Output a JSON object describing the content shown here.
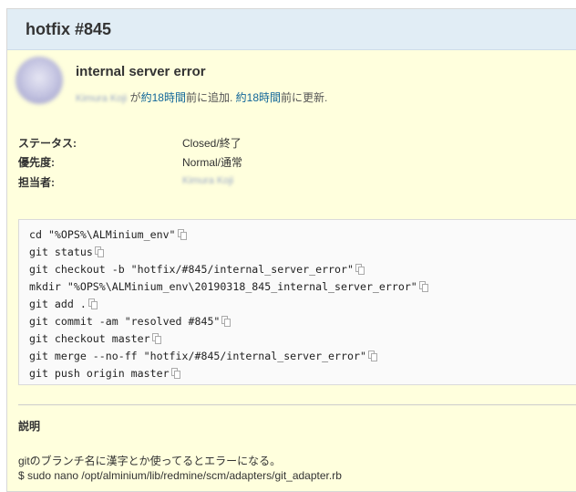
{
  "issue": {
    "title": "hotfix #845",
    "subject": "internal server error"
  },
  "meta": {
    "author": "Kimura Koji",
    "by": "が",
    "created_link": "約18時間",
    "created_suffix": "前に追加.",
    "updated_link": "約18時間",
    "updated_suffix": "前に更新."
  },
  "attributes": {
    "status_label": "ステータス:",
    "status_value": "Closed/終了",
    "priority_label": "優先度:",
    "priority_value": "Normal/通常",
    "assignee_label": "担当者:",
    "assignee_value": "Kimura Koji"
  },
  "code_lines": [
    "cd \"%OPS%\\ALMinium_env\"",
    "git status",
    "git checkout -b \"hotfix/#845/internal_server_error\"",
    "mkdir \"%OPS%\\ALMinium_env\\20190318_845_internal_server_error\"",
    "git add .",
    "git commit -am \"resolved #845\"",
    "git checkout master",
    "git merge --no-ff \"hotfix/#845/internal_server_error\"",
    "git push origin master"
  ],
  "description": {
    "heading": "説明",
    "line1": "gitのブランチ名に漢字とか使ってるとエラーになる。",
    "line2": "$ sudo nano /opt/alminium/lib/redmine/scm/adapters/git_adapter.rb"
  }
}
